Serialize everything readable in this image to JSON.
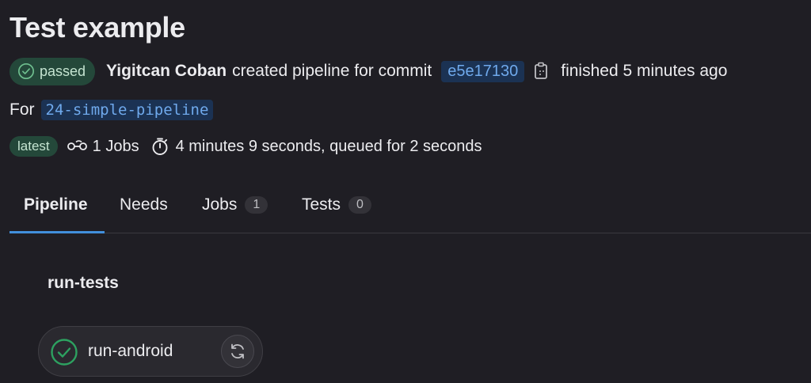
{
  "page": {
    "title": "Test example"
  },
  "pipeline": {
    "status_label": "passed",
    "status_icon": "check-circle-icon",
    "user": "Yigitcan Coban",
    "created_text": "created pipeline for commit",
    "commit": "e5e17130",
    "finished_text": "finished 5 minutes ago",
    "for_label": "For",
    "branch": "24-simple-pipeline",
    "latest_label": "latest",
    "jobs_text": "1 Jobs",
    "duration_text": "4 minutes 9 seconds, queued for 2 seconds"
  },
  "tabs": [
    {
      "label": "Pipeline",
      "active": true
    },
    {
      "label": "Needs"
    },
    {
      "label": "Jobs",
      "count": "1"
    },
    {
      "label": "Tests",
      "count": "0"
    }
  ],
  "stage": {
    "name": "run-tests",
    "jobs": [
      {
        "name": "run-android",
        "status_icon": "check-circle-icon",
        "action_icon": "retry-icon"
      }
    ]
  },
  "colors": {
    "success": "#2da160",
    "link": "#6fa9ec",
    "accent": "#428fdc"
  }
}
